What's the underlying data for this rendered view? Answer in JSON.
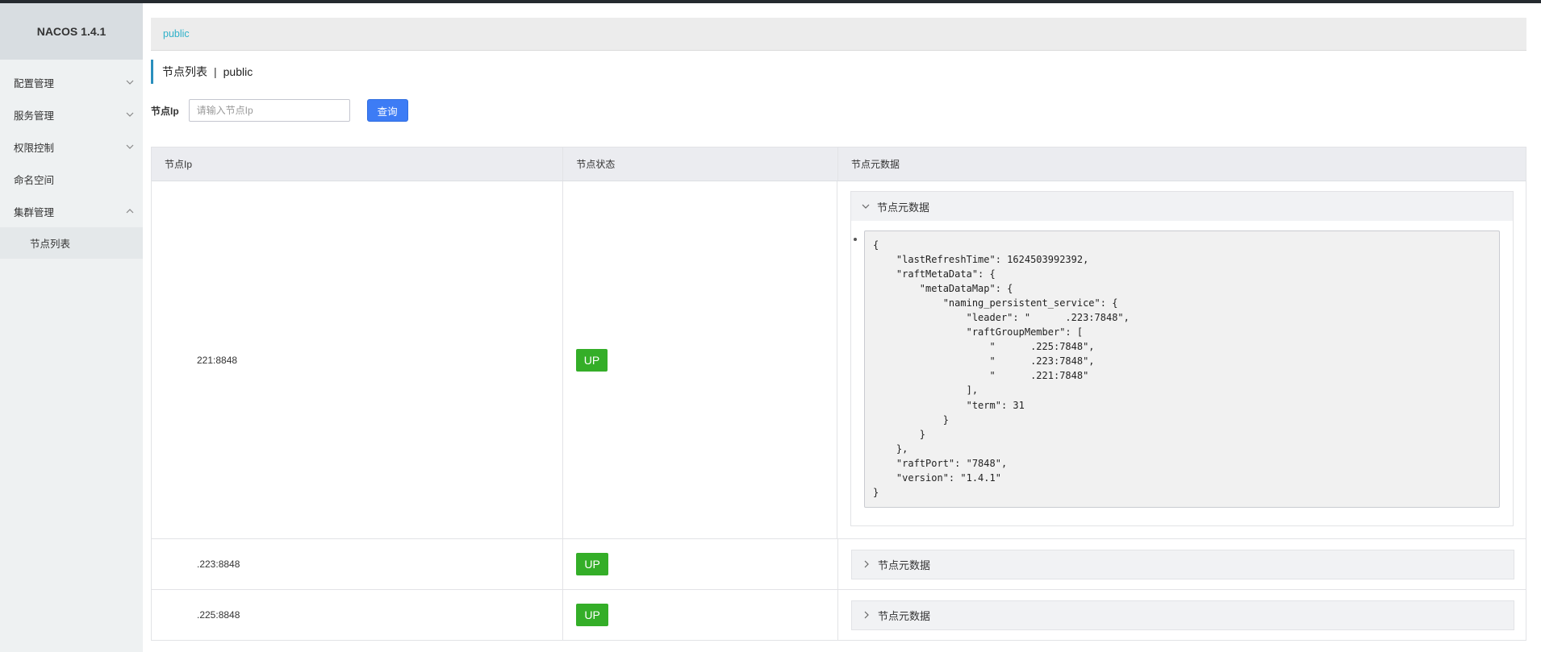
{
  "app": {
    "title": "NACOS 1.4.1"
  },
  "sidebar": {
    "items": [
      {
        "label": "配置管理",
        "expanded": false
      },
      {
        "label": "服务管理",
        "expanded": false
      },
      {
        "label": "权限控制",
        "expanded": false
      },
      {
        "label": "命名空间"
      },
      {
        "label": "集群管理",
        "expanded": true
      }
    ],
    "sub_items": [
      {
        "label": "节点列表"
      }
    ]
  },
  "breadcrumb": {
    "namespace": "public"
  },
  "page": {
    "title": "节点列表",
    "separator": "|",
    "namespace": "public"
  },
  "search": {
    "label": "节点Ip",
    "placeholder": "请输入节点Ip",
    "button": "查询"
  },
  "table": {
    "headers": [
      "节点Ip",
      "节点状态",
      "节点元数据"
    ],
    "rows": [
      {
        "ip": "221:8848",
        "status": "UP",
        "meta_label": "节点元数据",
        "expanded": true
      },
      {
        "ip": ".223:8848",
        "status": "UP",
        "meta_label": "节点元数据",
        "expanded": false
      },
      {
        "ip": ".225:8848",
        "status": "UP",
        "meta_label": "节点元数据",
        "expanded": false
      }
    ]
  },
  "metadata_json": "{\n    \"lastRefreshTime\": 1624503992392,\n    \"raftMetaData\": {\n        \"metaDataMap\": {\n            \"naming_persistent_service\": {\n                \"leader\": \"      .223:7848\",\n                \"raftGroupMember\": [\n                    \"      .225:7848\",\n                    \"      .223:7848\",\n                    \"      .221:7848\"\n                ],\n                \"term\": 31\n            }\n        }\n    },\n    \"raftPort\": \"7848\",\n    \"version\": \"1.4.1\"\n}",
  "colors": {
    "accent": "#2fb1c9",
    "primary": "#3d7cf5",
    "status_up": "#34ae28",
    "title_bar": "#2a8fbd"
  }
}
